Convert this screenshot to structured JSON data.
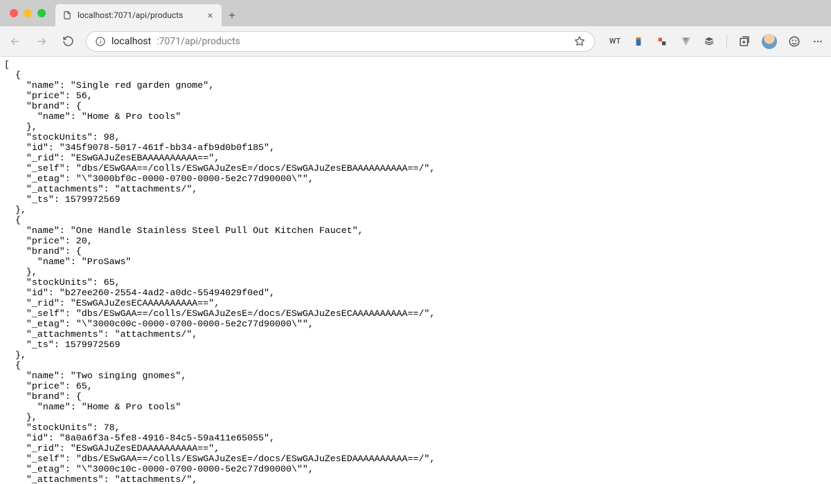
{
  "tab": {
    "title": "localhost:7071/api/products"
  },
  "addressbar": {
    "host": "localhost",
    "port_and_path": ":7071/api/products"
  },
  "extensions": {
    "wt_label": "WT"
  },
  "json_body": "[\n  {\n    \"name\": \"Single red garden gnome\",\n    \"price\": 56,\n    \"brand\": {\n      \"name\": \"Home & Pro tools\"\n    },\n    \"stockUnits\": 98,\n    \"id\": \"345f9078-5017-461f-bb34-afb9d0b0f185\",\n    \"_rid\": \"ESwGAJuZesEBAAAAAAAAAA==\",\n    \"_self\": \"dbs/ESwGAA==/colls/ESwGAJuZesE=/docs/ESwGAJuZesEBAAAAAAAAAA==/\",\n    \"_etag\": \"\\\"3000bf0c-0000-0700-0000-5e2c77d90000\\\"\",\n    \"_attachments\": \"attachments/\",\n    \"_ts\": 1579972569\n  },\n  {\n    \"name\": \"One Handle Stainless Steel Pull Out Kitchen Faucet\",\n    \"price\": 20,\n    \"brand\": {\n      \"name\": \"ProSaws\"\n    },\n    \"stockUnits\": 65,\n    \"id\": \"b27ee260-2554-4ad2-a0dc-55494029f0ed\",\n    \"_rid\": \"ESwGAJuZesECAAAAAAAAAA==\",\n    \"_self\": \"dbs/ESwGAA==/colls/ESwGAJuZesE=/docs/ESwGAJuZesECAAAAAAAAAA==/\",\n    \"_etag\": \"\\\"3000c00c-0000-0700-0000-5e2c77d90000\\\"\",\n    \"_attachments\": \"attachments/\",\n    \"_ts\": 1579972569\n  },\n  {\n    \"name\": \"Two singing gnomes\",\n    \"price\": 65,\n    \"brand\": {\n      \"name\": \"Home & Pro tools\"\n    },\n    \"stockUnits\": 78,\n    \"id\": \"8a0a6f3a-5fe8-4916-84c5-59a411e65055\",\n    \"_rid\": \"ESwGAJuZesEDAAAAAAAAAA==\",\n    \"_self\": \"dbs/ESwGAA==/colls/ESwGAJuZesE=/docs/ESwGAJuZesEDAAAAAAAAAA==/\",\n    \"_etag\": \"\\\"3000c10c-0000-0700-0000-5e2c77d90000\\\"\",\n    \"_attachments\": \"attachments/\","
}
